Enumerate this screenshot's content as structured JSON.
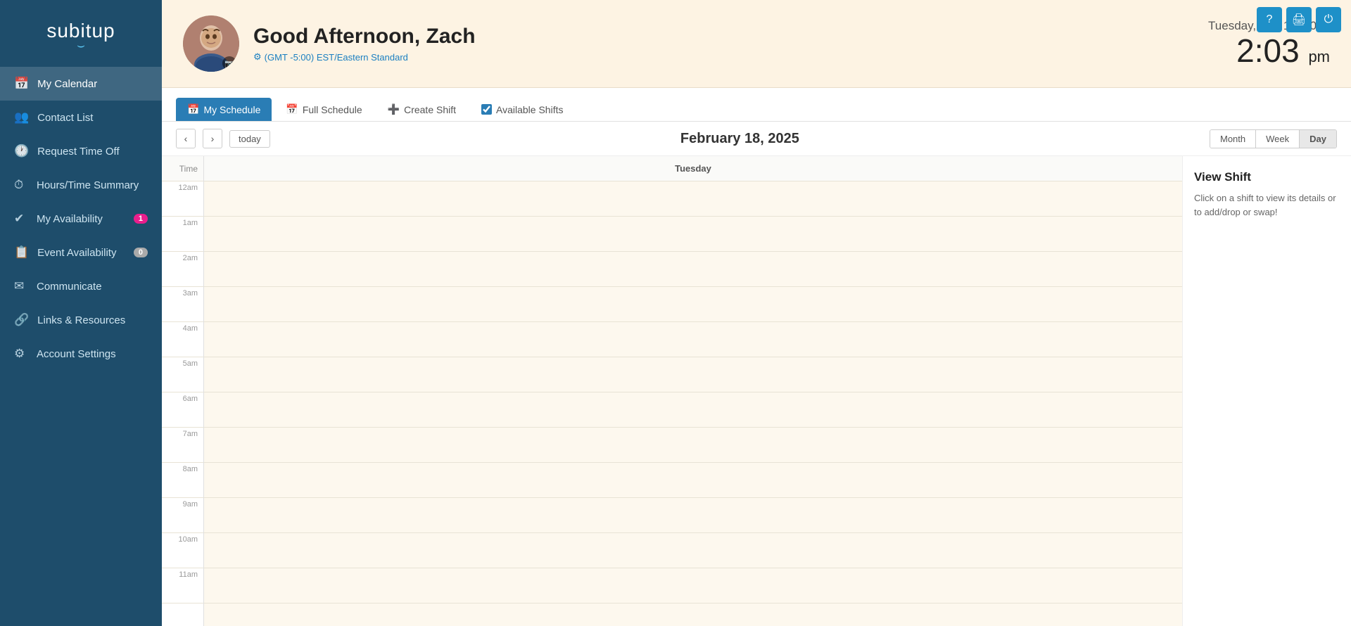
{
  "sidebar": {
    "logo": "subitup",
    "logo_smile": "⌣",
    "nav_items": [
      {
        "id": "my-calendar",
        "label": "My Calendar",
        "icon": "📅",
        "badge": null,
        "active": true
      },
      {
        "id": "contact-list",
        "label": "Contact List",
        "icon": "👥",
        "badge": null,
        "active": false
      },
      {
        "id": "request-time-off",
        "label": "Request Time Off",
        "icon": "🕐",
        "badge": null,
        "active": false
      },
      {
        "id": "hours-time-summary",
        "label": "Hours/Time Summary",
        "icon": "⏱",
        "badge": null,
        "active": false
      },
      {
        "id": "my-availability",
        "label": "My Availability",
        "icon": "✔",
        "badge": "1",
        "badge_zero": false,
        "active": false
      },
      {
        "id": "event-availability",
        "label": "Event Availability",
        "icon": "📋",
        "badge": "0",
        "badge_zero": true,
        "active": false
      },
      {
        "id": "communicate",
        "label": "Communicate",
        "icon": "✉",
        "badge": null,
        "active": false
      },
      {
        "id": "links-resources",
        "label": "Links & Resources",
        "icon": "🔗",
        "badge": null,
        "active": false
      },
      {
        "id": "account-settings",
        "label": "Account Settings",
        "icon": "⚙",
        "badge": null,
        "active": false
      }
    ]
  },
  "topbar": {
    "help_icon": "?",
    "print_icon": "🖨",
    "power_icon": "⏻"
  },
  "header": {
    "greeting": "Good Afternoon, Zach",
    "timezone_label": "(GMT -5:00) EST/Eastern Standard",
    "date": "Tuesday, Feb 18, 2025",
    "time": "2:03",
    "ampm": "pm"
  },
  "tabs": [
    {
      "id": "my-schedule",
      "label": "My Schedule",
      "icon": "📅",
      "active": true
    },
    {
      "id": "full-schedule",
      "label": "Full Schedule",
      "icon": "📅",
      "active": false
    },
    {
      "id": "create-shift",
      "label": "Create Shift",
      "icon": "➕",
      "active": false
    }
  ],
  "available_shifts": {
    "label": "Available Shifts",
    "checked": true
  },
  "calendar": {
    "current_date": "February 18, 2025",
    "today_btn": "today",
    "day_header": "Tuesday",
    "view_buttons": [
      {
        "id": "month",
        "label": "Month",
        "active": false
      },
      {
        "id": "week",
        "label": "Week",
        "active": false
      },
      {
        "id": "day",
        "label": "Day",
        "active": true
      }
    ],
    "time_slots": [
      "12am",
      "1am",
      "2am",
      "3am",
      "4am",
      "5am",
      "6am",
      "7am",
      "8am",
      "9am",
      "10am",
      "11am"
    ]
  },
  "right_panel": {
    "title": "View Shift",
    "description": "Click on a shift to view its details or to add/drop or swap!"
  }
}
